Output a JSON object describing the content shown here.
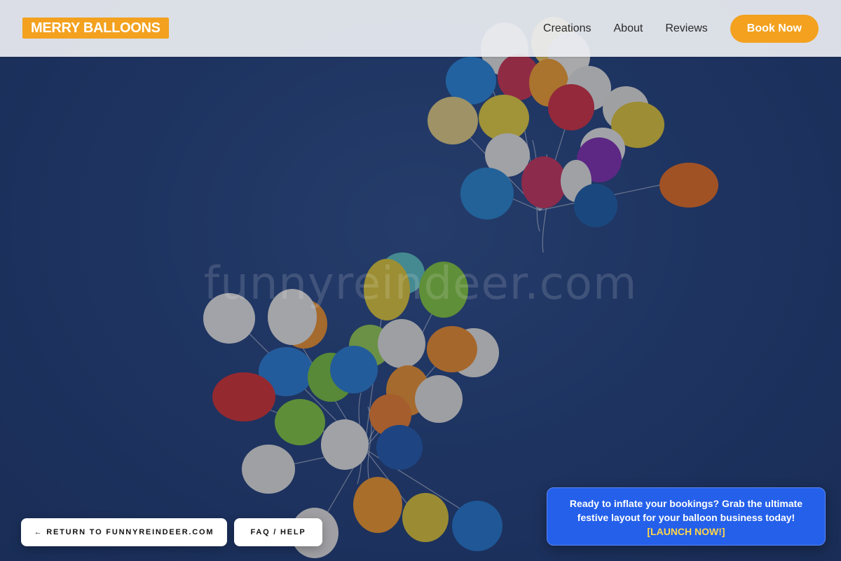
{
  "header": {
    "logo": "MERRY BALLOONS",
    "nav": [
      "Creations",
      "About",
      "Reviews"
    ],
    "book_label": "Book Now"
  },
  "hero": {
    "watermark": "funnyreindeer.com"
  },
  "bottom_bar": {
    "return_label": "← RETURN TO FUNNYREINDEER.COM",
    "faq_label": "FAQ / HELP"
  },
  "promo": {
    "text": "Ready to inflate your bookings? Grab the ultimate festive layout for your balloon business today!",
    "cta": "[LAUNCH NOW!]"
  },
  "colors": {
    "accent": "#f3a11e",
    "promo_bg": "#2460ea",
    "promo_cta": "#ffd54a",
    "sky": "#253f72"
  }
}
